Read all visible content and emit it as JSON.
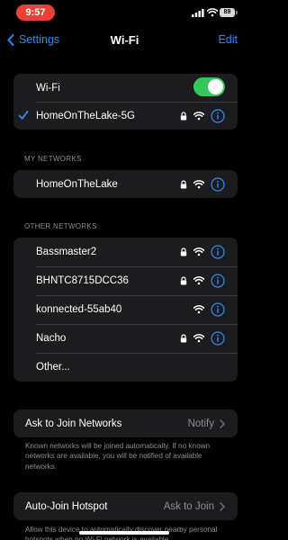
{
  "status_bar": {
    "time": "9:57",
    "battery": "89"
  },
  "nav": {
    "back_label": "Settings",
    "title": "Wi-Fi",
    "edit_label": "Edit"
  },
  "current": {
    "wifi_label": "Wi-Fi",
    "wifi_on": true,
    "connected_network": "HomeOnTheLake-5G"
  },
  "my_networks": {
    "header": "MY NETWORKS",
    "items": [
      {
        "name": "HomeOnTheLake",
        "secured": true
      }
    ]
  },
  "other_networks": {
    "header": "OTHER NETWORKS",
    "items": [
      {
        "name": "Bassmaster2",
        "secured": true
      },
      {
        "name": "BHNTC8715DCC36",
        "secured": true
      },
      {
        "name": "konnected-55ab40",
        "secured": false
      },
      {
        "name": "Nacho",
        "secured": true
      }
    ],
    "other_label": "Other..."
  },
  "ask_to_join": {
    "label": "Ask to Join Networks",
    "value": "Notify",
    "footnote": "Known networks will be joined automatically. If no known networks are available, you will be notified of available networks."
  },
  "auto_join": {
    "label": "Auto-Join Hotspot",
    "value": "Ask to Join",
    "footnote": "Allow this device to automatically discover nearby personal hotspots when no Wi-Fi network is available."
  },
  "colors": {
    "accent": "#2f8cf4",
    "toggle_on": "#34c759",
    "row_bg": "#1c1c1e",
    "secondary_text": "#8e8e93",
    "time_pill": "#eb4037"
  }
}
